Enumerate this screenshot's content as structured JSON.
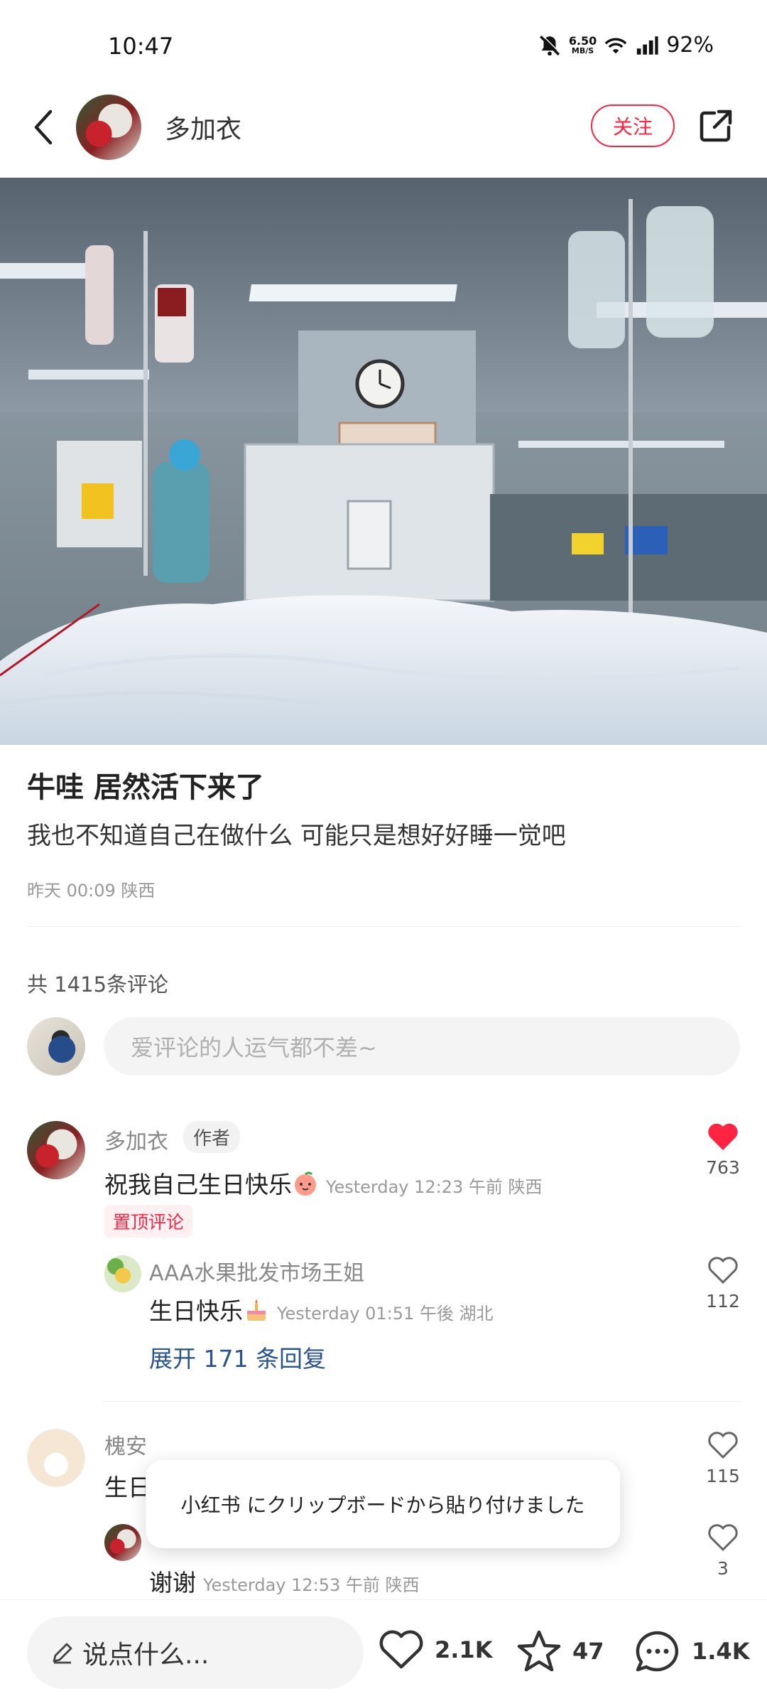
{
  "status_bar": {
    "time": "10:47",
    "net_speed_value": "6.50",
    "net_speed_unit": "MB/S",
    "battery": "92%"
  },
  "header": {
    "author_name": "多加衣",
    "follow_label": "关注"
  },
  "post": {
    "title": "牛哇 居然活下来了",
    "body": "我也不知道自己在做什么 可能只是想好好睡一觉吧",
    "meta": "昨天 00:09 陕西"
  },
  "comments_section": {
    "count_label": "共 1415条评论",
    "input_placeholder": "爱评论的人运气都不差~"
  },
  "comments": [
    {
      "name": "多加衣",
      "tag": "作者",
      "text": "祝我自己生日快乐",
      "meta": "Yesterday 12:23 午前 陕西",
      "pinned_label": "置顶评论",
      "likes": "763",
      "liked": true,
      "reply": {
        "name": "AAA水果批发市场王姐",
        "text": "生日快乐",
        "meta": "Yesterday 01:51 午後 湖北",
        "likes": "112"
      },
      "expand_label": "展开 171 条回复"
    },
    {
      "name": "槐安",
      "text": "生日",
      "likes": "115",
      "reply": {
        "text": "谢谢",
        "meta": "Yesterday 12:53 午前 陕西",
        "likes": "3"
      }
    }
  ],
  "toast": {
    "text": "小红书 にクリップボードから貼り付けました"
  },
  "bottom_bar": {
    "input_placeholder": "说点什么...",
    "likes": "2.1K",
    "collects": "47",
    "comments": "1.4K"
  },
  "colors": {
    "accent": "#ff2442",
    "link": "#2a5490"
  }
}
